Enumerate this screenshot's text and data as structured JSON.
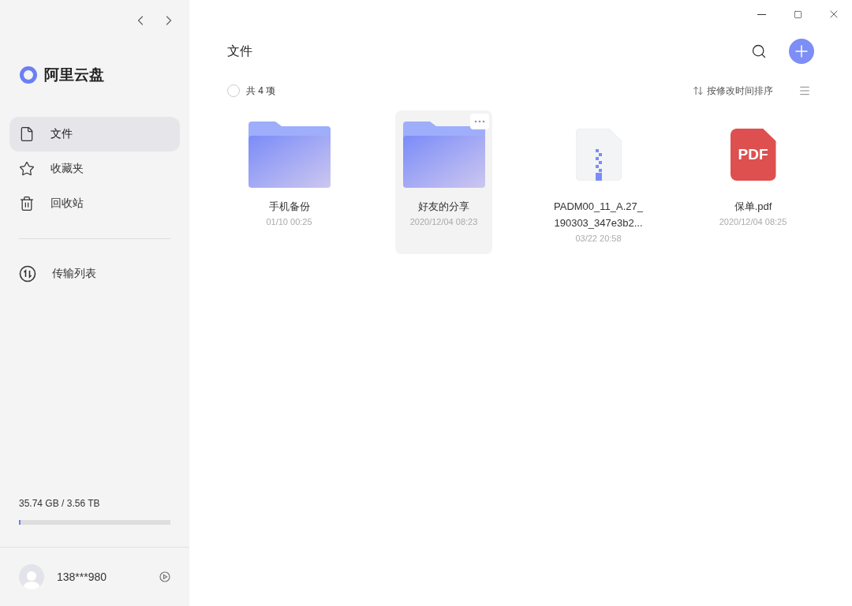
{
  "brand": {
    "name": "阿里云盘"
  },
  "nav": [
    {
      "label": "文件",
      "selected": true
    },
    {
      "label": "收藏夹",
      "selected": false
    },
    {
      "label": "回收站",
      "selected": false
    }
  ],
  "nav_secondary": [
    {
      "label": "传输列表",
      "selected": false
    }
  ],
  "storage": {
    "text": "35.74 GB / 3.56 TB",
    "level": 0.01
  },
  "user": {
    "name": "138***980"
  },
  "header": {
    "title": "文件"
  },
  "toolbar": {
    "count": "共 4 项",
    "sort": "按修改时间排序",
    "select_all_checked": false
  },
  "files": [
    {
      "kind": "folder",
      "name": "手机备份",
      "date": "01/10 00:25",
      "selected": false
    },
    {
      "kind": "folder",
      "name": "好友的分享",
      "date": "2020/12/04 08:23",
      "selected": true
    },
    {
      "kind": "zip",
      "name": "PADM00_11_A.27_190303_347e3b2...",
      "date": "03/22 20:58",
      "selected": false
    },
    {
      "kind": "pdf",
      "name": "保单.pdf",
      "date": "2020/12/04 08:25",
      "selected": false,
      "badge": "PDF"
    }
  ]
}
